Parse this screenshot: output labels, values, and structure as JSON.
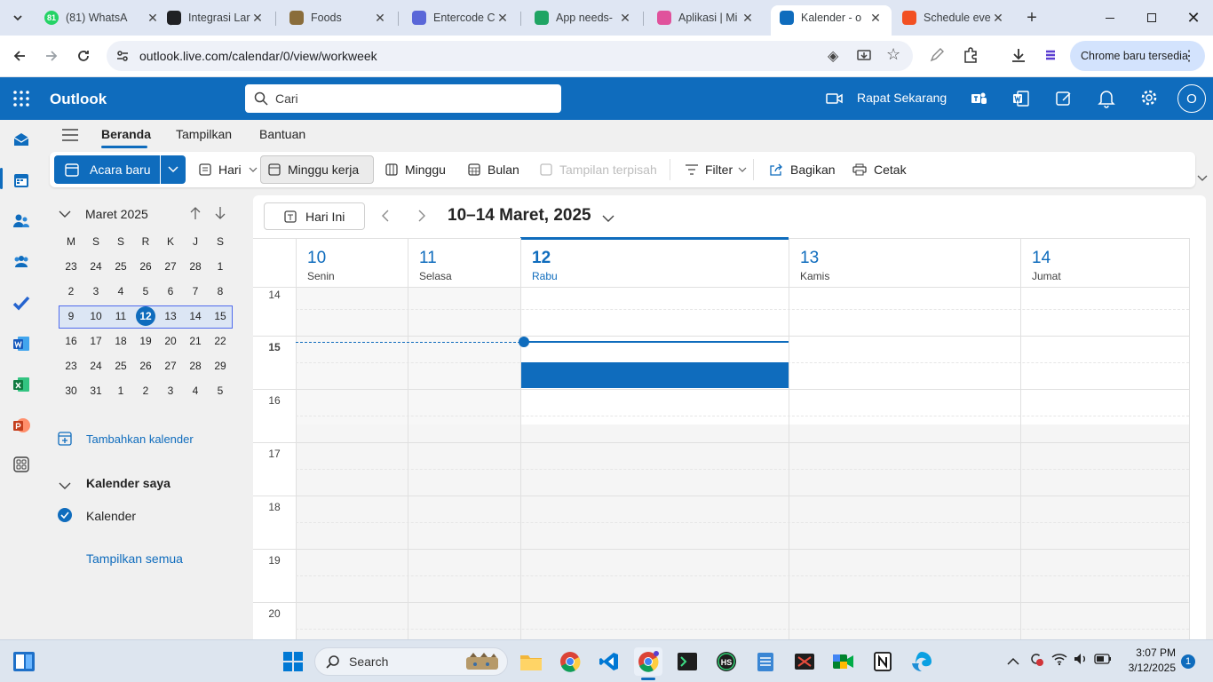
{
  "browser": {
    "tabs": [
      {
        "title": "(81) WhatsA",
        "badge": "81",
        "color": "#25d366"
      },
      {
        "title": "Integrasi Lar",
        "color": "#202124"
      },
      {
        "title": "Foods",
        "color": "#8a6d3b"
      },
      {
        "title": "Entercode Cl",
        "color": "#5a67d8"
      },
      {
        "title": "App needs-",
        "color": "#1fa463"
      },
      {
        "title": "Aplikasi | Mi",
        "color": "#e0529c"
      },
      {
        "title": "Kalender - o",
        "color": "#0f6cbd"
      },
      {
        "title": "Schedule eve",
        "color": "#f25022"
      }
    ],
    "url": "outlook.live.com/calendar/0/view/workweek",
    "update_label": "Chrome baru tersedia"
  },
  "outlook": {
    "app_name": "Outlook",
    "search_placeholder": "Cari",
    "meet_now": "Rapat Sekarang",
    "avatar_initial": "O"
  },
  "ribbon": {
    "tabs": [
      "Beranda",
      "Tampilkan",
      "Bantuan"
    ],
    "new_event": "Acara baru",
    "day": "Hari",
    "work_week": "Minggu kerja",
    "week": "Minggu",
    "month": "Bulan",
    "split_view": "Tampilan terpisah",
    "filter": "Filter",
    "share": "Bagikan",
    "print": "Cetak"
  },
  "mini_calendar": {
    "month_label": "Maret 2025",
    "weekdays": [
      "M",
      "S",
      "S",
      "R",
      "K",
      "J",
      "S"
    ],
    "weeks": [
      [
        "23",
        "24",
        "25",
        "26",
        "27",
        "28",
        "1"
      ],
      [
        "2",
        "3",
        "4",
        "5",
        "6",
        "7",
        "8"
      ],
      [
        "9",
        "10",
        "11",
        "12",
        "13",
        "14",
        "15"
      ],
      [
        "16",
        "17",
        "18",
        "19",
        "20",
        "21",
        "22"
      ],
      [
        "23",
        "24",
        "25",
        "26",
        "27",
        "28",
        "29"
      ],
      [
        "30",
        "31",
        "1",
        "2",
        "3",
        "4",
        "5"
      ]
    ],
    "today": "12"
  },
  "sidebar": {
    "add_calendar": "Tambahkan kalender",
    "my_calendars": "Kalender saya",
    "calendar_item": "Kalender",
    "show_all": "Tampilkan semua"
  },
  "calendar": {
    "today_button": "Hari Ini",
    "range_label": "10–14 Maret, 2025",
    "days": [
      {
        "num": "10",
        "name": "Senin"
      },
      {
        "num": "11",
        "name": "Selasa"
      },
      {
        "num": "12",
        "name": "Rabu"
      },
      {
        "num": "13",
        "name": "Kamis"
      },
      {
        "num": "14",
        "name": "Jumat"
      }
    ],
    "hours": [
      "14",
      "15",
      "16",
      "17",
      "18",
      "19",
      "20"
    ]
  },
  "taskbar": {
    "search": "Search",
    "time": "3:07 PM",
    "date": "3/12/2025",
    "notification_count": "1"
  }
}
